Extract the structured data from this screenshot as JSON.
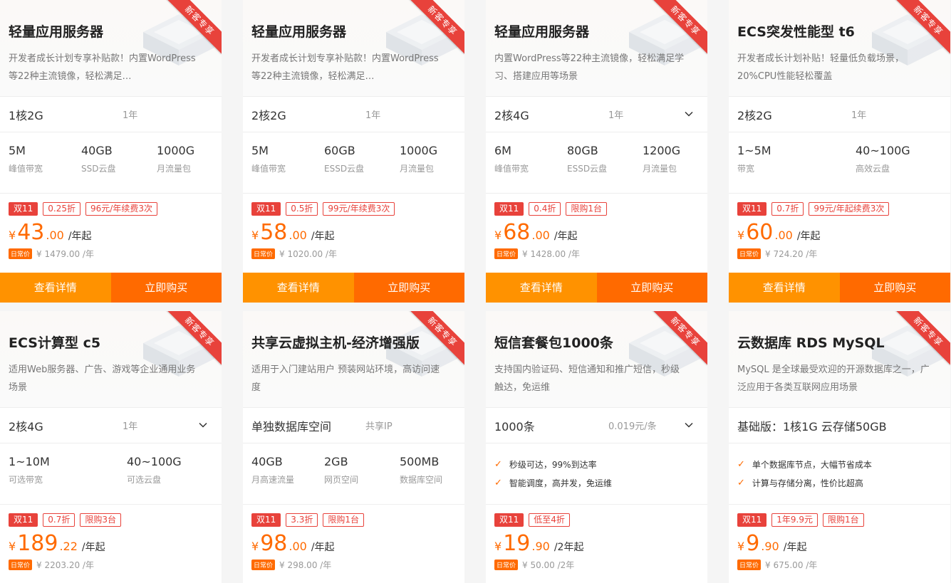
{
  "ribbon": "新客专享",
  "buttons": {
    "detail": "查看详情",
    "buy": "立即购买"
  },
  "orig_badge": "日常价",
  "cards": [
    {
      "title": "轻量应用服务器",
      "desc": "开发者成长计划专享补贴款！内置WordPress等22种主流镜像，轻松满足…",
      "spec": "1核2G",
      "term": "1年",
      "dropdown": false,
      "params": [
        {
          "v": "5M",
          "l": "峰值带宽"
        },
        {
          "v": "40GB",
          "l": "SSD云盘"
        },
        {
          "v": "1000G",
          "l": "月流量包"
        }
      ],
      "tags": [
        "双11",
        "0.25折",
        "96元/年续费3次"
      ],
      "price_int": "43",
      "price_dec": ".00",
      "unit": "/年起",
      "orig": "¥ 1479.00 /年"
    },
    {
      "title": "轻量应用服务器",
      "desc": "开发者成长计划专享补贴款！内置WordPress等22种主流镜像，轻松满足…",
      "spec": "2核2G",
      "term": "1年",
      "dropdown": false,
      "params": [
        {
          "v": "5M",
          "l": "峰值带宽"
        },
        {
          "v": "60GB",
          "l": "ESSD云盘"
        },
        {
          "v": "1000G",
          "l": "月流量包"
        }
      ],
      "tags": [
        "双11",
        "0.5折",
        "99元/年续费3次"
      ],
      "price_int": "58",
      "price_dec": ".00",
      "unit": "/年起",
      "orig": "¥ 1020.00 /年"
    },
    {
      "title": "轻量应用服务器",
      "desc": "内置WordPress等22种主流镜像，轻松满足学习、搭建应用等场景",
      "spec": "2核4G",
      "term": "1年",
      "dropdown": true,
      "params": [
        {
          "v": "6M",
          "l": "峰值带宽"
        },
        {
          "v": "80GB",
          "l": "ESSD云盘"
        },
        {
          "v": "1200G",
          "l": "月流量包"
        }
      ],
      "tags": [
        "双11",
        "0.4折",
        "限购1台"
      ],
      "price_int": "68",
      "price_dec": ".00",
      "unit": "/年起",
      "orig": "¥ 1428.00 /年"
    },
    {
      "title": "ECS突发性能型 t6",
      "desc": "开发者成长计划补贴！轻量低负载场景，20%CPU性能轻松覆盖",
      "spec": "2核2G",
      "term": "1年",
      "dropdown": false,
      "params": [
        {
          "v": "1~5M",
          "l": "带宽"
        },
        {
          "v": "40~100G",
          "l": "高效云盘"
        }
      ],
      "tags": [
        "双11",
        "0.7折",
        "99元/年起续费3次"
      ],
      "price_int": "60",
      "price_dec": ".00",
      "unit": "/年起",
      "orig": "¥ 724.20 /年"
    },
    {
      "title": "ECS计算型 c5",
      "desc": "适用Web服务器、广告、游戏等企业通用业务场景",
      "spec": "2核4G",
      "term": "1年",
      "dropdown": true,
      "params": [
        {
          "v": "1~10M",
          "l": "可选带宽"
        },
        {
          "v": "40~100G",
          "l": "可选云盘"
        }
      ],
      "tags": [
        "双11",
        "0.7折",
        "限购3台"
      ],
      "price_int": "189",
      "price_dec": ".22",
      "unit": "/年起",
      "orig": "¥ 2203.20 /年"
    },
    {
      "title": "共享云虚拟主机-经济增强版",
      "desc": "适用于入门建站用户 预装网站环境，高访问速度",
      "spec": "单独数据库空间",
      "term": "共享IP",
      "dropdown": false,
      "params": [
        {
          "v": "40GB",
          "l": "月高速流量"
        },
        {
          "v": "2GB",
          "l": "网页空间"
        },
        {
          "v": "500MB",
          "l": "数据库空间"
        }
      ],
      "tags": [
        "双11",
        "3.3折",
        "限购1台"
      ],
      "price_int": "98",
      "price_dec": ".00",
      "unit": "/年起",
      "orig": "¥ 298.00 /年"
    },
    {
      "title": "短信套餐包1000条",
      "desc": "支持国内验证码、短信通知和推广短信，秒级触达，免运维",
      "spec": "1000条",
      "term": "0.019元/条",
      "dropdown": true,
      "features": [
        "秒级可达，99%到达率",
        "智能调度，高并发，免运维"
      ],
      "tags": [
        "双11",
        "低至4折"
      ],
      "price_int": "19",
      "price_dec": ".90",
      "unit": "/2年起",
      "orig": "¥ 50.00 /2年"
    },
    {
      "title": "云数据库 RDS MySQL",
      "desc": "MySQL 是全球最受欢迎的开源数据库之一，广泛应用于各类互联网应用场景",
      "spec": "基础版：1核1G 云存储50GB",
      "term": "",
      "dropdown": false,
      "features": [
        "单个数据库节点，大幅节省成本",
        "计算与存储分离，性价比超高"
      ],
      "tags": [
        "双11",
        "1年9.9元",
        "限购1台"
      ],
      "price_int": "9",
      "price_dec": ".90",
      "unit": "/年起",
      "orig": "¥ 675.00 /年"
    }
  ]
}
